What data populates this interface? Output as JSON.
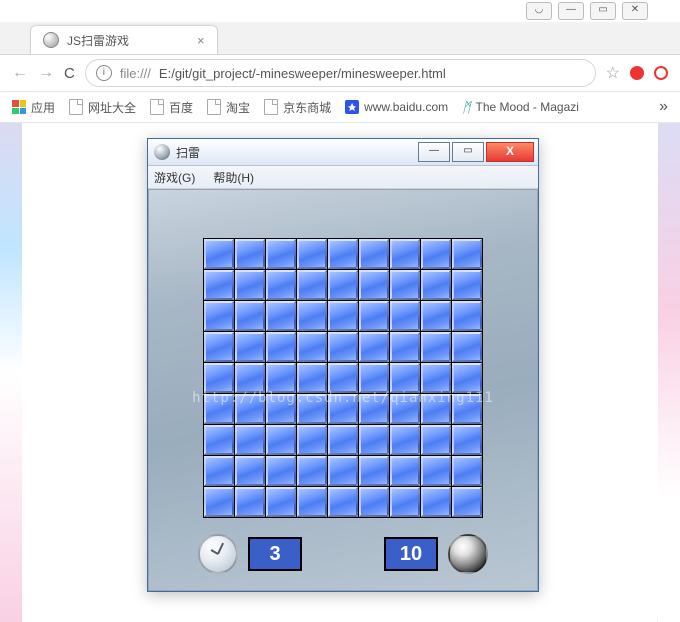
{
  "os_buttons": {
    "user": "◡",
    "min": "—",
    "max": "▭",
    "close": "✕"
  },
  "tab": {
    "title": "JS扫雷游戏",
    "close": "×"
  },
  "nav": {
    "back": "←",
    "fwd": "→",
    "reload": "C"
  },
  "omnibox": {
    "info": "i",
    "protocol": "file:///",
    "path": "E:/git/git_project/-minesweeper/minesweeper.html",
    "star": "☆"
  },
  "bookmarks": {
    "apps": "应用",
    "items": [
      {
        "label": "网址大全"
      },
      {
        "label": "百度"
      },
      {
        "label": "淘宝"
      },
      {
        "label": "京东商城"
      }
    ],
    "baidu": "www.baidu.com",
    "mood_prefix": "ᛗ",
    "mood": "The Mood - Magazi",
    "more": "»"
  },
  "minesweeper": {
    "title": "扫雷",
    "controls": {
      "min": "—",
      "max": "▭",
      "close": "X"
    },
    "menu": {
      "game": "游戏(G)",
      "help": "帮助(H)"
    },
    "grid": {
      "rows": 9,
      "cols": 9
    },
    "status": {
      "time": "3",
      "mines": "10"
    }
  },
  "watermark": "http://blog.csdn.net/qianxing111"
}
